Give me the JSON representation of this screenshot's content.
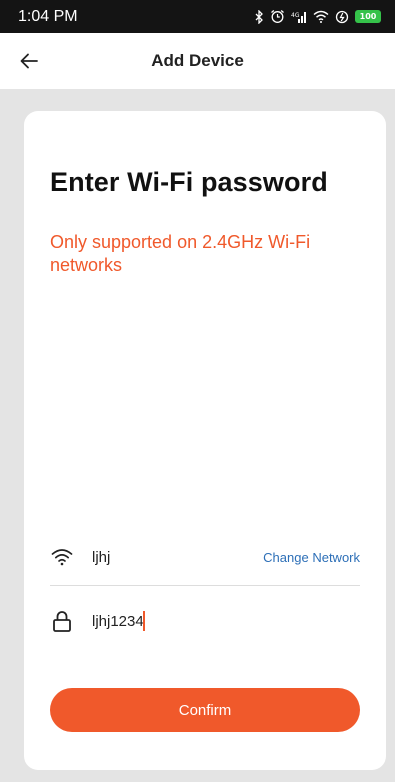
{
  "status_bar": {
    "time": "1:04 PM",
    "battery_level": "100",
    "icons": [
      "bluetooth-icon",
      "alarm-icon",
      "cellular-signal-icon",
      "wifi-signal-icon",
      "data-saver-icon",
      "battery-icon"
    ]
  },
  "app_bar": {
    "title": "Add Device",
    "back_icon": "arrow-left-icon"
  },
  "card": {
    "heading": "Enter Wi-Fi password",
    "notice": "Only supported on 2.4GHz Wi-Fi networks",
    "network": {
      "icon": "wifi-icon",
      "name": "ljhj",
      "change_label": "Change Network"
    },
    "password": {
      "icon": "lock-icon",
      "value": "ljhj1234"
    },
    "confirm_label": "Confirm"
  },
  "colors": {
    "accent": "#f0592b",
    "link": "#2d6fb7",
    "background": "#e4e4e4",
    "status_bar": "#141414"
  }
}
